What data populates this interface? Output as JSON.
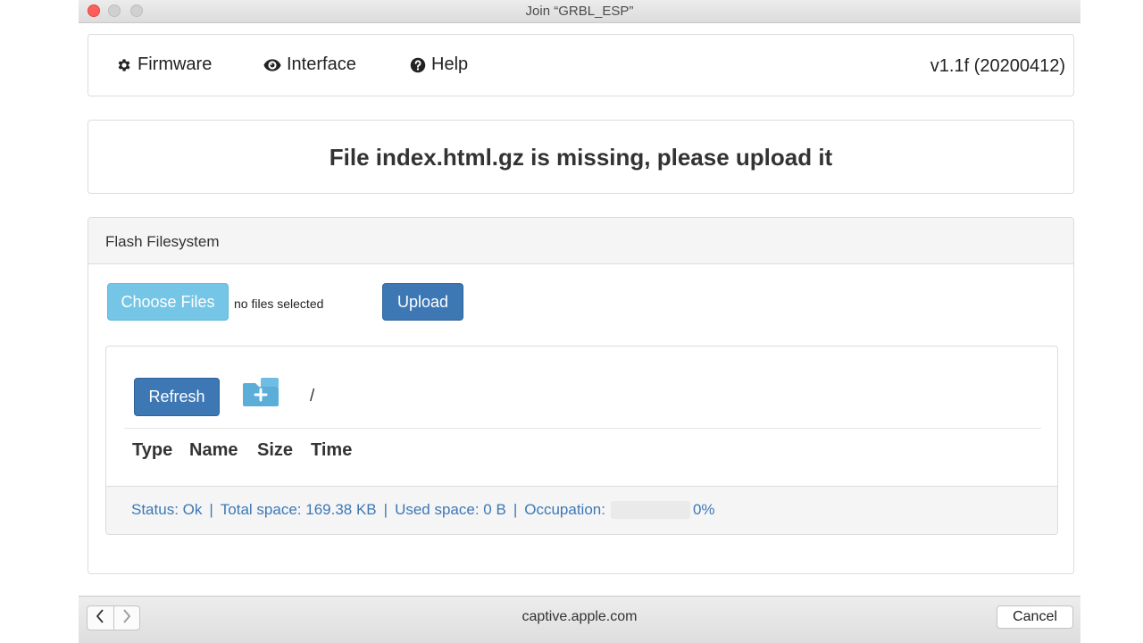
{
  "window": {
    "title": "Join “GRBL_ESP”"
  },
  "nav": {
    "items": [
      {
        "label": "Firmware",
        "icon": "gear-icon"
      },
      {
        "label": "Interface",
        "icon": "eye-icon"
      },
      {
        "label": "Help",
        "icon": "question-circle-icon"
      }
    ],
    "version": "v1.1f (20200412)"
  },
  "alert": {
    "message": "File index.html.gz is missing, please upload it"
  },
  "filesystem": {
    "heading": "Flash Filesystem",
    "choose_label": "Choose Files",
    "no_files_text": "no files selected",
    "upload_label": "Upload",
    "refresh_label": "Refresh",
    "new_folder_icon": "folder-plus-icon",
    "path": "/",
    "columns": [
      "Type",
      "Name",
      "Size",
      "Time"
    ],
    "status": {
      "status_text": "Status: Ok",
      "total_text": "Total space: 169.38 KB",
      "used_text": "Used space: 0 B",
      "occupation_label": "Occupation:",
      "occupation_value": 0,
      "occupation_text": "0%"
    }
  },
  "colors": {
    "primary": "#3d78b5",
    "info": "#74c5e6",
    "close": "#fe5f57"
  },
  "bottom": {
    "url": "captive.apple.com",
    "cancel_label": "Cancel"
  }
}
